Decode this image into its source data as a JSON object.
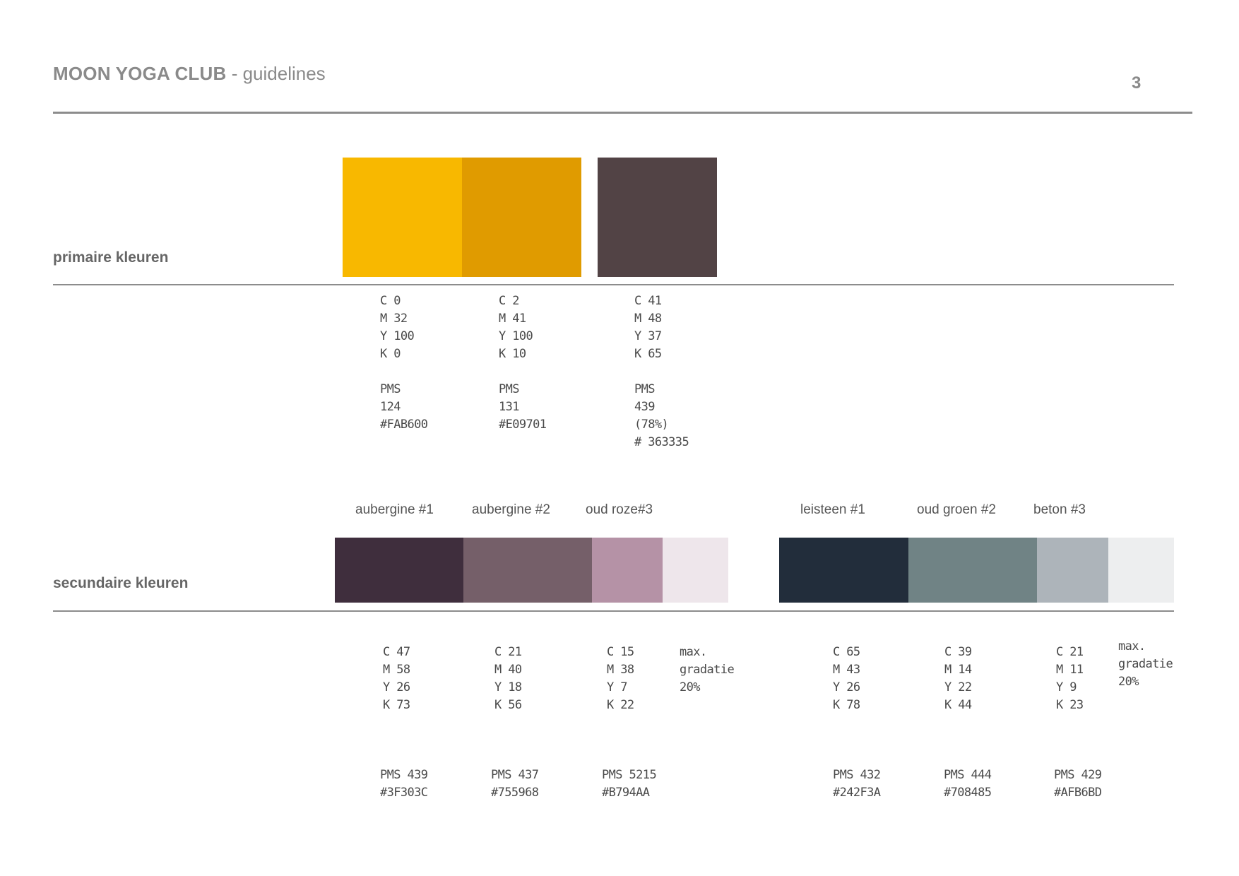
{
  "header": {
    "brand": "MOON YOGA CLUB",
    "separator": " - ",
    "subtitle": "guidelines",
    "page_number": "3"
  },
  "primary": {
    "title": "primaire kleuren",
    "colors": [
      {
        "hex": "#F8B800",
        "specs": [
          "C 0",
          "M 32",
          "Y 100",
          "K 0",
          "",
          "PMS",
          "124",
          "#FAB600"
        ]
      },
      {
        "hex": "#E09B00",
        "specs": [
          "C 2",
          "M 41",
          "Y 100",
          "K 10",
          "",
          "PMS",
          "131",
          "#E09701"
        ]
      },
      {
        "hex": "#524345",
        "specs": [
          "C 41",
          "M 48",
          "Y 37",
          "K 65",
          "",
          "PMS",
          "439",
          "(78%)",
          "# 363335"
        ]
      }
    ]
  },
  "secondary": {
    "title": "secundaire kleuren",
    "groups": [
      {
        "colors": [
          {
            "name": "aubergine #1",
            "hex": "#3F2E3D",
            "cmyk": [
              "C 47",
              "M 58",
              "Y 26",
              "K 73"
            ],
            "pms": [
              "PMS 439",
              "#3F303C"
            ]
          },
          {
            "name": "aubergine #2",
            "hex": "#755F69",
            "cmyk": [
              "C 21",
              "M 40",
              "Y 18",
              "K 56"
            ],
            "pms": [
              "PMS 437",
              "#755968"
            ]
          },
          {
            "name": "oud roze#3",
            "hex": "#B592A6",
            "cmyk": [
              "C 15",
              "M 38",
              "Y 7",
              "K 22"
            ],
            "pms": [
              "PMS 5215",
              "#B794AA"
            ]
          }
        ],
        "tint_hex": "#EEE6EB",
        "gradient_note": [
          "max.",
          "gradatie",
          "20%"
        ]
      },
      {
        "colors": [
          {
            "name": "leisteen #1",
            "hex": "#222D3B",
            "cmyk": [
              "C 65",
              "M 43",
              "Y 26",
              "K 78"
            ],
            "pms": [
              "PMS 432",
              "#242F3A"
            ]
          },
          {
            "name": "oud groen #2",
            "hex": "#708385",
            "cmyk": [
              "C 39",
              "M 14",
              "Y 22",
              "K 44"
            ],
            "pms": [
              "PMS 444",
              "#708485"
            ]
          },
          {
            "name": "beton #3",
            "hex": "#ADB4BA",
            "cmyk": [
              "C 21",
              "M 11",
              "Y 9",
              "K 23"
            ],
            "pms": [
              "PMS 429",
              "#AFB6BD"
            ]
          }
        ],
        "tint_hex": "#EDEEEF",
        "gradient_note": [
          "max.",
          "gradatie",
          "20%"
        ]
      }
    ]
  }
}
